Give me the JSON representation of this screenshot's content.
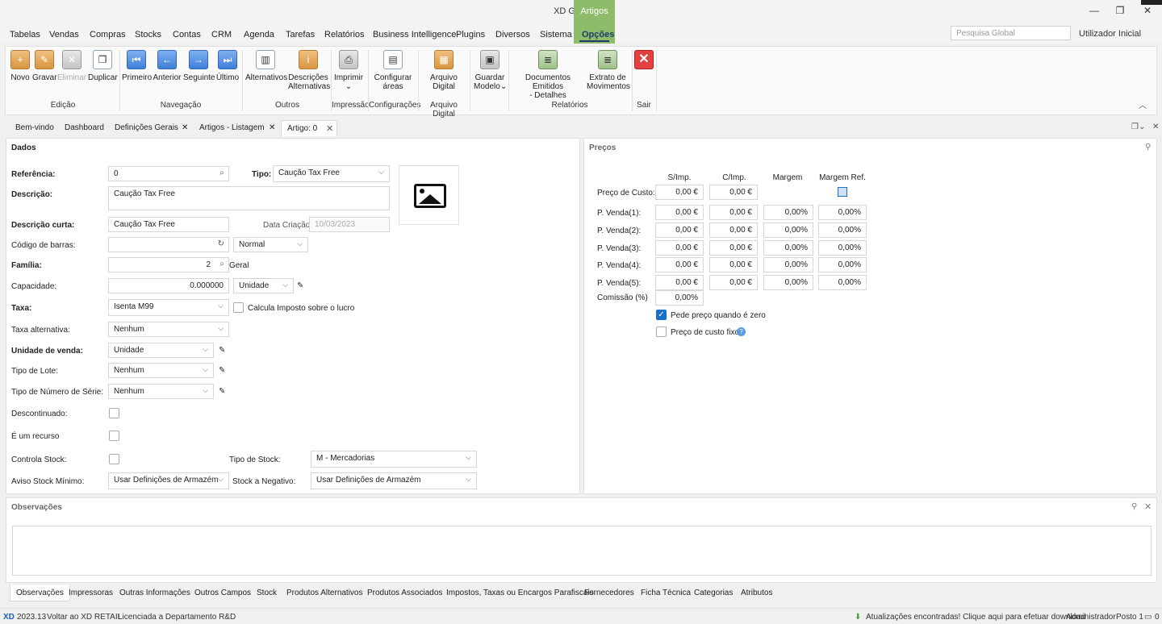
{
  "window": {
    "title": "XD GC - POS",
    "context_tab": "Artigos",
    "minimize": "—",
    "maximize": "❐",
    "close": "✕"
  },
  "menu": {
    "items": [
      "Tabelas",
      "Vendas",
      "Compras",
      "Stocks",
      "Contas",
      "CRM",
      "Agenda",
      "Tarefas",
      "Relatórios",
      "Business Intelligence",
      "Plugins",
      "Diversos",
      "Sistema",
      "Opções"
    ],
    "active": "Opções",
    "search_placeholder": "Pesquisa Global",
    "user": "Utilizador Inicial"
  },
  "ribbon": {
    "buttons": {
      "novo": "Novo",
      "gravar": "Gravar",
      "eliminar": "Eliminar",
      "duplicar": "Duplicar",
      "primeiro": "Primeiro",
      "anterior": "Anterior",
      "seguinte": "Seguinte",
      "ultimo": "Último",
      "alternativos": "Alternativos",
      "descricoes_1": "Descrições",
      "descricoes_2": "Alternativas",
      "imprimir": "Imprimir",
      "configurar_1": "Configurar",
      "configurar_2": "áreas",
      "arquivo_1": "Arquivo",
      "arquivo_2": "Digital",
      "guardar_1": "Guardar",
      "guardar_2": "Modelo",
      "docs_1": "Documentos Emitidos",
      "docs_2": "- Detalhes",
      "extrato_1": "Extrato de",
      "extrato_2": "Movimentos",
      "sair": "Sair"
    },
    "groups": {
      "edicao": "Edição",
      "navegacao": "Navegação",
      "outros": "Outros",
      "impressao": "Impressão",
      "configuracoes": "Configurações",
      "arquivo_digital": "Arquivo Digital",
      "relatorios": "Relatórios",
      "sair": "Sair"
    }
  },
  "doc_tabs": [
    "Bem-vindo",
    "Dashboard",
    "Definições Gerais",
    "Artigos - Listagem",
    "Artigo: 0"
  ],
  "dados": {
    "title": "Dados",
    "referencia_label": "Referência:",
    "referencia": "0",
    "tipo_label": "Tipo:",
    "tipo": "Caução Tax Free",
    "descricao_label": "Descrição:",
    "descricao": "Caução Tax Free",
    "descricao_curta_label": "Descrição curta:",
    "descricao_curta": "Caução Tax Free",
    "data_criacao_label": "Data Criação:",
    "data_criacao": "10/03/2023",
    "codigo_barras_label": "Código de barras:",
    "codigo_barras": "",
    "codigo_tipo": "Normal",
    "familia_label": "Família:",
    "familia": "2",
    "familia_nome": "Geral",
    "capacidade_label": "Capacidade:",
    "capacidade": "0.000000",
    "capacidade_unidade": "Unidade",
    "taxa_label": "Taxa:",
    "taxa": "Isenta M99",
    "calcula_imposto": "Calcula Imposto sobre o lucro",
    "taxa_alternativa_label": "Taxa alternativa:",
    "taxa_alternativa": "Nenhum",
    "unidade_venda_label": "Unidade de venda:",
    "unidade_venda": "Unidade",
    "tipo_lote_label": "Tipo de Lote:",
    "tipo_lote": "Nenhum",
    "tipo_num_serie_label": "Tipo de Número de Série:",
    "tipo_num_serie": "Nenhum",
    "descontinuado_label": "Descontinuado:",
    "recurso_label": "É um recurso",
    "controla_stock_label": "Controla Stock:",
    "tipo_stock_label": "Tipo de Stock:",
    "tipo_stock": "M - Mercadorias",
    "aviso_stock_label": "Aviso Stock Mínimo:",
    "aviso_stock": "Usar Definições de Armazém",
    "stock_negativo_label": "Stock a Negativo:",
    "stock_negativo": "Usar Definições de Armazém"
  },
  "precos": {
    "title": "Preços",
    "headers": [
      "S/Imp.",
      "C/Imp.",
      "Margem",
      "Margem Ref."
    ],
    "custo_label": "Preço de Custo:",
    "custo_s": "0,00 €",
    "custo_c": "0,00 €",
    "rows": [
      {
        "label": "P. Venda(1):",
        "s": "0,00 €",
        "c": "0,00 €",
        "m": "0,00%",
        "mr": "0,00%"
      },
      {
        "label": "P. Venda(2):",
        "s": "0,00 €",
        "c": "0,00 €",
        "m": "0,00%",
        "mr": "0,00%"
      },
      {
        "label": "P. Venda(3):",
        "s": "0,00 €",
        "c": "0,00 €",
        "m": "0,00%",
        "mr": "0,00%"
      },
      {
        "label": "P. Venda(4):",
        "s": "0,00 €",
        "c": "0,00 €",
        "m": "0,00%",
        "mr": "0,00%"
      },
      {
        "label": "P. Venda(5):",
        "s": "0,00 €",
        "c": "0,00 €",
        "m": "0,00%",
        "mr": "0,00%"
      }
    ],
    "comissao_label": "Comissão (%)",
    "comissao": "0,00%",
    "pede_preco": "Pede preço quando é zero",
    "preco_custo_fixo": "Preço de custo fixo"
  },
  "observacoes": {
    "title": "Observações",
    "text": ""
  },
  "bottom_tabs": [
    "Observações",
    "Impressoras",
    "Outras Informações",
    "Outros Campos",
    "Stock",
    "Produtos Alternativos",
    "Produtos Associados",
    "Impostos, Taxas ou Encargos Parafiscais",
    "Fornecedores",
    "Ficha Técnica",
    "Categorias",
    "Atributos"
  ],
  "status": {
    "logo": "XD",
    "version": "2023.13",
    "back": "Voltar ao XD RETAIL",
    "license": "Licenciada a Departamento R&D",
    "updates": "Atualizações encontradas! Clique aqui para efetuar download",
    "user": "Administrador",
    "posto": "Posto 1",
    "messages": "0"
  },
  "colors": {
    "accent_green": "#8fbc6a",
    "accent_blue": "#1a6fc9",
    "close_red": "#e34040"
  }
}
